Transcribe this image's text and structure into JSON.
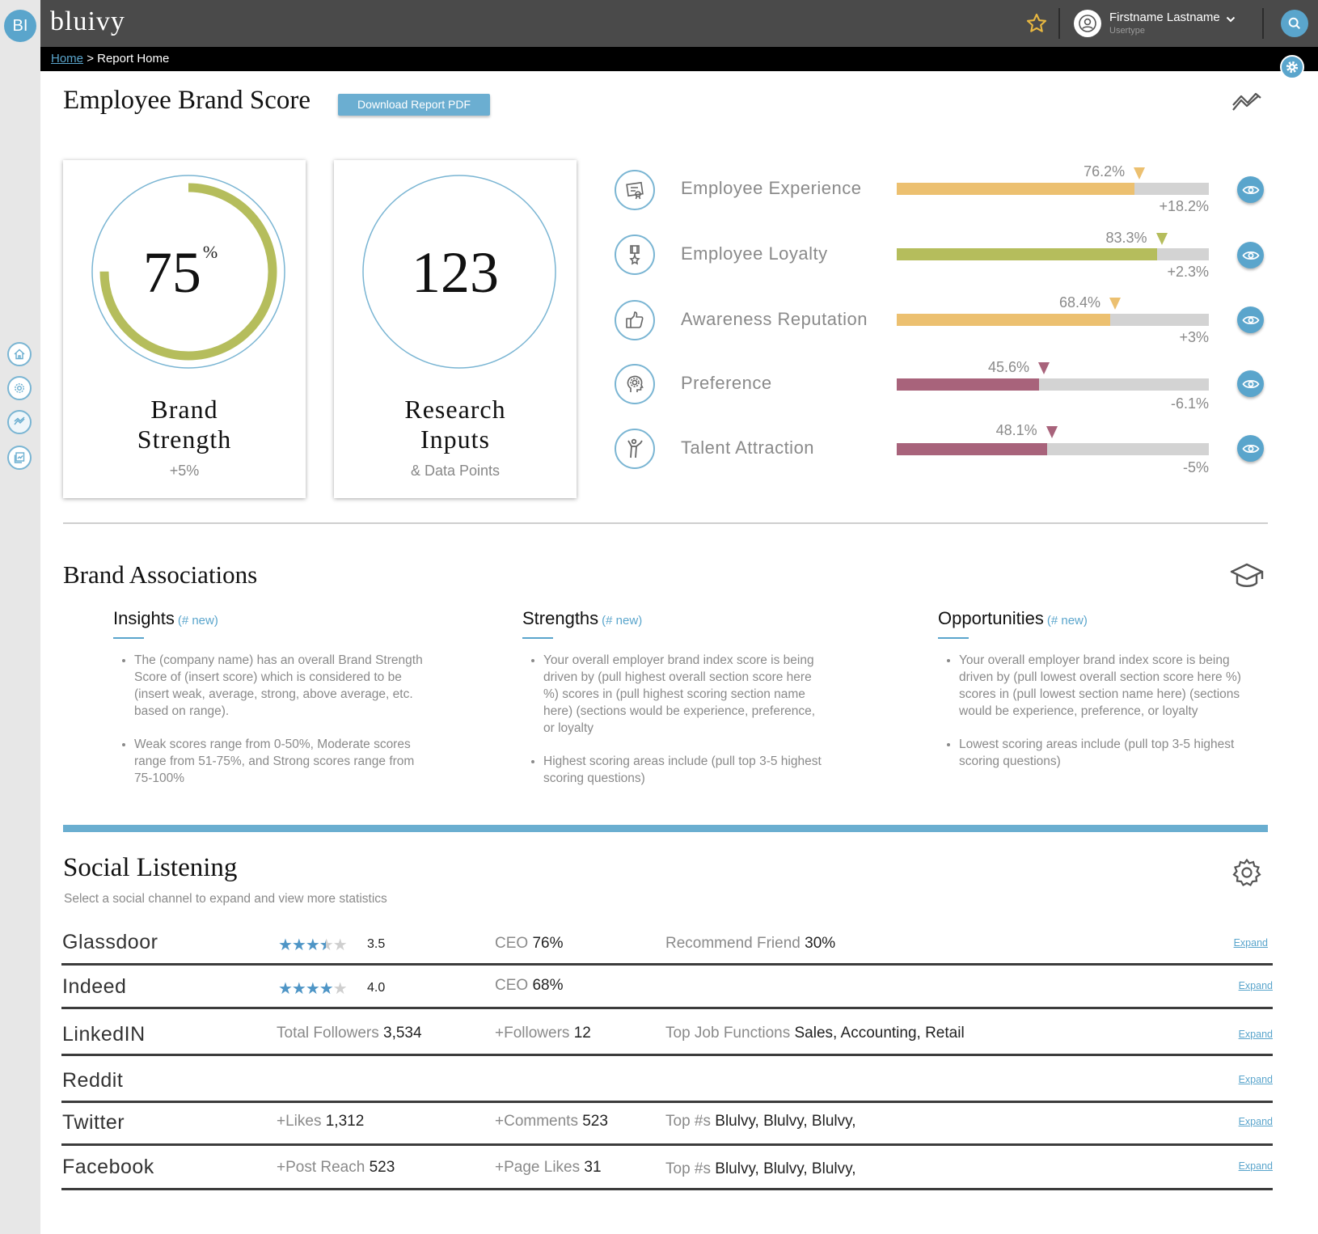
{
  "app": {
    "logo_initials": "BI",
    "brand": "bluivy"
  },
  "user": {
    "name": "Firstname Lastname",
    "type": "Usertype"
  },
  "breadcrumb": {
    "home": "Home",
    "separator": ">",
    "current": "Report Home"
  },
  "header": {
    "title": "Employee Brand Score",
    "download_label": "Download Report PDF"
  },
  "cards": [
    {
      "value": "75",
      "unit": "%",
      "title_line1": "Brand",
      "title_line2": "Strength",
      "sub": "+5%",
      "progress_fraction": 0.75
    },
    {
      "value": "123",
      "title_line1": "Research",
      "title_line2": "Inputs",
      "sub": "& Data Points"
    }
  ],
  "metrics": [
    {
      "label": "Employee Experience",
      "value": "76.2%",
      "value_num": 76.2,
      "change": "+18.2%",
      "color": "#ecc070",
      "icon": "certificate-icon"
    },
    {
      "label": "Employee Loyalty",
      "value": "83.3%",
      "value_num": 83.3,
      "change": "+2.3%",
      "color": "#b5bd5c",
      "icon": "award-ribbon-icon"
    },
    {
      "label": "Awareness Reputation",
      "value": "68.4%",
      "value_num": 68.4,
      "change": "+3%",
      "color": "#ecc070",
      "icon": "thumbs-up-icon"
    },
    {
      "label": "Preference",
      "value": "45.6%",
      "value_num": 45.6,
      "change": "-6.1%",
      "color": "#a8637b",
      "icon": "head-gear-icon"
    },
    {
      "label": "Talent Attraction",
      "value": "48.1%",
      "value_num": 48.1,
      "change": "-5%",
      "color": "#a8637b",
      "icon": "person-walking-icon"
    }
  ],
  "brand_associations": {
    "title": "Brand Associations",
    "columns": [
      {
        "heading": "Insights",
        "new_label": "(# new)",
        "items": [
          "The (company name) has an overall Brand Strength Score of (insert score) which is considered to be (insert weak, average, strong, above average, etc. based on range).",
          "Weak scores range from 0-50%, Moderate scores range from 51-75%, and Strong scores range from 75-100%"
        ]
      },
      {
        "heading": "Strengths",
        "new_label": "(# new)",
        "items": [
          "Your overall employer brand index score is being driven by (pull highest overall section score here %) scores in (pull highest scoring section name here) (sections would be experience, preference, or loyalty",
          "Highest scoring areas include (pull top 3-5 highest scoring questions)"
        ]
      },
      {
        "heading": "Opportunities",
        "new_label": "(# new)",
        "items": [
          "Your overall employer brand index score is being driven by (pull lowest overall section score here %) scores in (pull lowest section name here) (sections would be experience, preference, or loyalty",
          "Lowest scoring areas include (pull top 3-5 highest scoring questions)"
        ]
      }
    ]
  },
  "social": {
    "title": "Social Listening",
    "subtitle": "Select a social channel to expand and view more statistics",
    "expand_label": "Expand",
    "rows": [
      {
        "name": "Glassdoor",
        "stars": 3.5,
        "rating": "3.5",
        "c2l": "CEO",
        "c2v": "76%",
        "c3l": "Recommend Friend",
        "c3v": "30%"
      },
      {
        "name": "Indeed",
        "stars": 4,
        "rating": "4.0",
        "c2l": "CEO",
        "c2v": "68%",
        "c3l": "",
        "c3v": ""
      },
      {
        "name": "LinkedIN",
        "c1l": "Total Followers",
        "c1v": "3,534",
        "c2l": "+Followers",
        "c2v": "12",
        "c3l": "Top Job Functions",
        "c3v": "Sales, Accounting, Retail"
      },
      {
        "name": "Reddit"
      },
      {
        "name": "Twitter",
        "c1l": "+Likes",
        "c1v": "1,312",
        "c2l": "+Comments",
        "c2v": "523",
        "c3l": "Top #s",
        "c3v": "Blulvy, Blulvy, Blulvy,"
      },
      {
        "name": "Facebook",
        "c1l": "+Post Reach",
        "c1v": "523",
        "c2l": "+Page Likes",
        "c2v": "31",
        "c3l": "Top #s",
        "c3v": "Blulvy, Blulvy, Blulvy,"
      }
    ]
  },
  "colors": {
    "accent": "#5aa5cc",
    "topbar": "#4a4a4a",
    "gauge": "#b5bd5c"
  }
}
